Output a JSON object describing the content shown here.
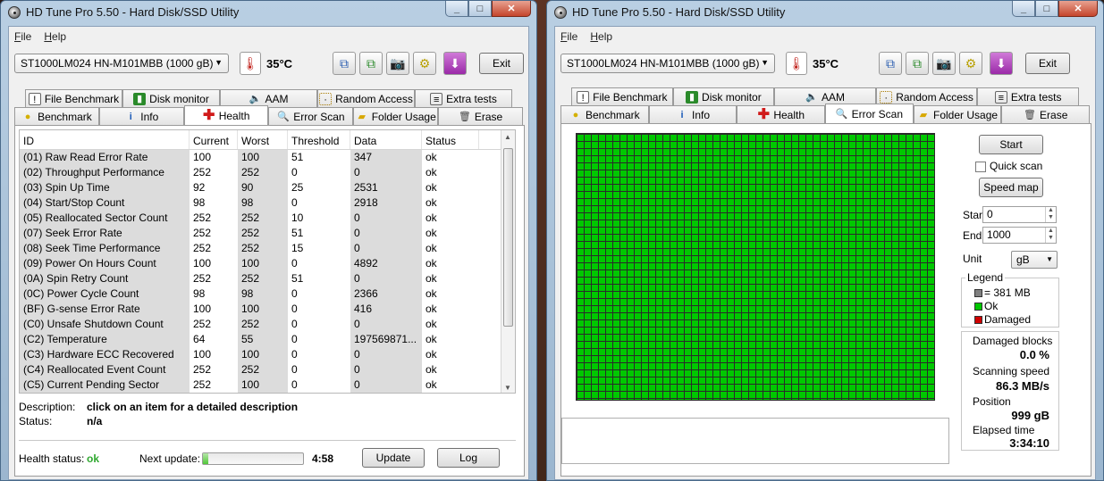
{
  "windows": {
    "left": {
      "title": "HD Tune Pro 5.50 - Hard Disk/SSD Utility",
      "menu": [
        "File",
        "Help"
      ],
      "drive": "ST1000LM024 HN-M101MBB (1000 gB)",
      "temperature": "35°C",
      "exit_label": "Exit",
      "tabs_top": [
        {
          "label": "File Benchmark",
          "icon": "file-benchmark-icon"
        },
        {
          "label": "Disk monitor",
          "icon": "disk-monitor-icon"
        },
        {
          "label": "AAM",
          "icon": "speaker-icon"
        },
        {
          "label": "Random Access",
          "icon": "random-access-icon"
        },
        {
          "label": "Extra tests",
          "icon": "extra-tests-icon"
        }
      ],
      "tabs_bottom": [
        {
          "label": "Benchmark",
          "icon": "bulb-icon"
        },
        {
          "label": "Info",
          "icon": "info-icon"
        },
        {
          "label": "Health",
          "icon": "health-cross-icon",
          "active": true
        },
        {
          "label": "Error Scan",
          "icon": "magnifier-icon"
        },
        {
          "label": "Folder Usage",
          "icon": "folder-icon"
        },
        {
          "label": "Erase",
          "icon": "trash-icon"
        }
      ],
      "health": {
        "columns": [
          "ID",
          "Current",
          "Worst",
          "Threshold",
          "Data",
          "Status"
        ],
        "rows": [
          [
            "(01) Raw Read Error Rate",
            "100",
            "100",
            "51",
            "347",
            "ok"
          ],
          [
            "(02) Throughput Performance",
            "252",
            "252",
            "0",
            "0",
            "ok"
          ],
          [
            "(03) Spin Up Time",
            "92",
            "90",
            "25",
            "2531",
            "ok"
          ],
          [
            "(04) Start/Stop Count",
            "98",
            "98",
            "0",
            "2918",
            "ok"
          ],
          [
            "(05) Reallocated Sector Count",
            "252",
            "252",
            "10",
            "0",
            "ok"
          ],
          [
            "(07) Seek Error Rate",
            "252",
            "252",
            "51",
            "0",
            "ok"
          ],
          [
            "(08) Seek Time Performance",
            "252",
            "252",
            "15",
            "0",
            "ok"
          ],
          [
            "(09) Power On Hours Count",
            "100",
            "100",
            "0",
            "4892",
            "ok"
          ],
          [
            "(0A) Spin Retry Count",
            "252",
            "252",
            "51",
            "0",
            "ok"
          ],
          [
            "(0C) Power Cycle Count",
            "98",
            "98",
            "0",
            "2366",
            "ok"
          ],
          [
            "(BF) G-sense Error Rate",
            "100",
            "100",
            "0",
            "416",
            "ok"
          ],
          [
            "(C0) Unsafe Shutdown Count",
            "252",
            "252",
            "0",
            "0",
            "ok"
          ],
          [
            "(C2) Temperature",
            "64",
            "55",
            "0",
            "197569871...",
            "ok"
          ],
          [
            "(C3) Hardware ECC Recovered",
            "100",
            "100",
            "0",
            "0",
            "ok"
          ],
          [
            "(C4) Reallocated Event Count",
            "252",
            "252",
            "0",
            "0",
            "ok"
          ],
          [
            "(C5) Current Pending Sector",
            "252",
            "100",
            "0",
            "0",
            "ok"
          ]
        ],
        "description_label": "Description:",
        "description_value": "click on an item for a detailed description",
        "status_label": "Status:",
        "status_value": "n/a",
        "health_status_label": "Health status:",
        "health_status_value": "ok",
        "next_update_label": "Next update:",
        "next_update_value": "4:58",
        "next_update_progress": 0.05,
        "update_label": "Update",
        "log_label": "Log"
      }
    },
    "right": {
      "title": "HD Tune Pro 5.50 - Hard Disk/SSD Utility",
      "menu": [
        "File",
        "Help"
      ],
      "drive": "ST1000LM024 HN-M101MBB (1000 gB)",
      "temperature": "35°C",
      "exit_label": "Exit",
      "tabs_top": [
        {
          "label": "File Benchmark",
          "icon": "file-benchmark-icon"
        },
        {
          "label": "Disk monitor",
          "icon": "disk-monitor-icon"
        },
        {
          "label": "AAM",
          "icon": "speaker-icon"
        },
        {
          "label": "Random Access",
          "icon": "random-access-icon"
        },
        {
          "label": "Extra tests",
          "icon": "extra-tests-icon"
        }
      ],
      "tabs_bottom": [
        {
          "label": "Benchmark",
          "icon": "bulb-icon"
        },
        {
          "label": "Info",
          "icon": "info-icon"
        },
        {
          "label": "Health",
          "icon": "health-cross-icon"
        },
        {
          "label": "Error Scan",
          "icon": "magnifier-icon",
          "active": true
        },
        {
          "label": "Folder Usage",
          "icon": "folder-icon"
        },
        {
          "label": "Erase",
          "icon": "trash-icon"
        }
      ],
      "error_scan": {
        "start_label": "Start",
        "quick_scan_label": "Quick scan",
        "speed_map_label": "Speed map",
        "start_field_label": "Start",
        "start_value": "0",
        "end_field_label": "End",
        "end_value": "1000",
        "unit_label": "Unit",
        "unit_value": "gB",
        "legend_title": "Legend",
        "legend_block": "= 381 MB",
        "legend_ok": "Ok",
        "legend_damaged": "Damaged",
        "damaged_blocks_label": "Damaged blocks",
        "damaged_blocks_value": "0.0 %",
        "scanning_speed_label": "Scanning speed",
        "scanning_speed_value": "86.3 MB/s",
        "position_label": "Position",
        "position_value": "999 gB",
        "elapsed_label": "Elapsed time",
        "elapsed_value": "3:34:10"
      }
    }
  },
  "colors": {
    "ok_green": "#00c800",
    "damaged_red": "#d00000",
    "block_gray": "#808080",
    "status_ok": "#2fa82f"
  }
}
